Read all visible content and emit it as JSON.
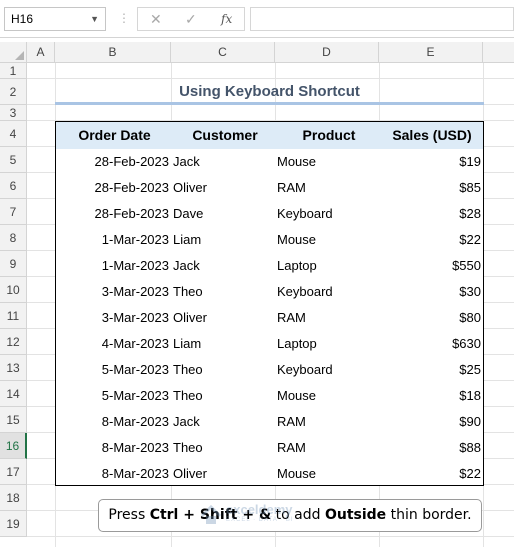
{
  "formula_bar": {
    "name_box": "H16",
    "cancel_icon": "✕",
    "enter_icon": "✓",
    "fx_label": "fx",
    "formula": ""
  },
  "columns": [
    "A",
    "B",
    "C",
    "D",
    "E"
  ],
  "rows": [
    "1",
    "2",
    "3",
    "4",
    "5",
    "6",
    "7",
    "8",
    "9",
    "10",
    "11",
    "12",
    "13",
    "14",
    "15",
    "16",
    "17",
    "18",
    "19"
  ],
  "active_row": "16",
  "sheet": {
    "title": "Using Keyboard Shortcut",
    "headers": [
      "Order Date",
      "Customer",
      "Product",
      "Sales (USD)"
    ],
    "data": [
      [
        "28-Feb-2023",
        "Jack",
        "Mouse",
        "$19"
      ],
      [
        "28-Feb-2023",
        "Oliver",
        "RAM",
        "$85"
      ],
      [
        "28-Feb-2023",
        "Dave",
        "Keyboard",
        "$28"
      ],
      [
        "1-Mar-2023",
        "Liam",
        "Mouse",
        "$22"
      ],
      [
        "1-Mar-2023",
        "Jack",
        "Laptop",
        "$550"
      ],
      [
        "3-Mar-2023",
        "Theo",
        "Keyboard",
        "$30"
      ],
      [
        "3-Mar-2023",
        "Oliver",
        "RAM",
        "$80"
      ],
      [
        "4-Mar-2023",
        "Liam",
        "Laptop",
        "$630"
      ],
      [
        "5-Mar-2023",
        "Theo",
        "Keyboard",
        "$25"
      ],
      [
        "5-Mar-2023",
        "Theo",
        "Mouse",
        "$18"
      ],
      [
        "8-Mar-2023",
        "Jack",
        "RAM",
        "$90"
      ],
      [
        "8-Mar-2023",
        "Theo",
        "RAM",
        "$88"
      ],
      [
        "8-Mar-2023",
        "Oliver",
        "Mouse",
        "$22"
      ]
    ]
  },
  "note": {
    "pre": "Press ",
    "k1": "Ctrl",
    "p1": " + ",
    "k2": "Shift",
    "p2": " + ",
    "k3": "&",
    "p3": " to add ",
    "k4": "Outside",
    "p4": " thin border."
  },
  "watermark": {
    "name": "exceldemy",
    "tagline": "EXCEL · DATA · BI"
  }
}
